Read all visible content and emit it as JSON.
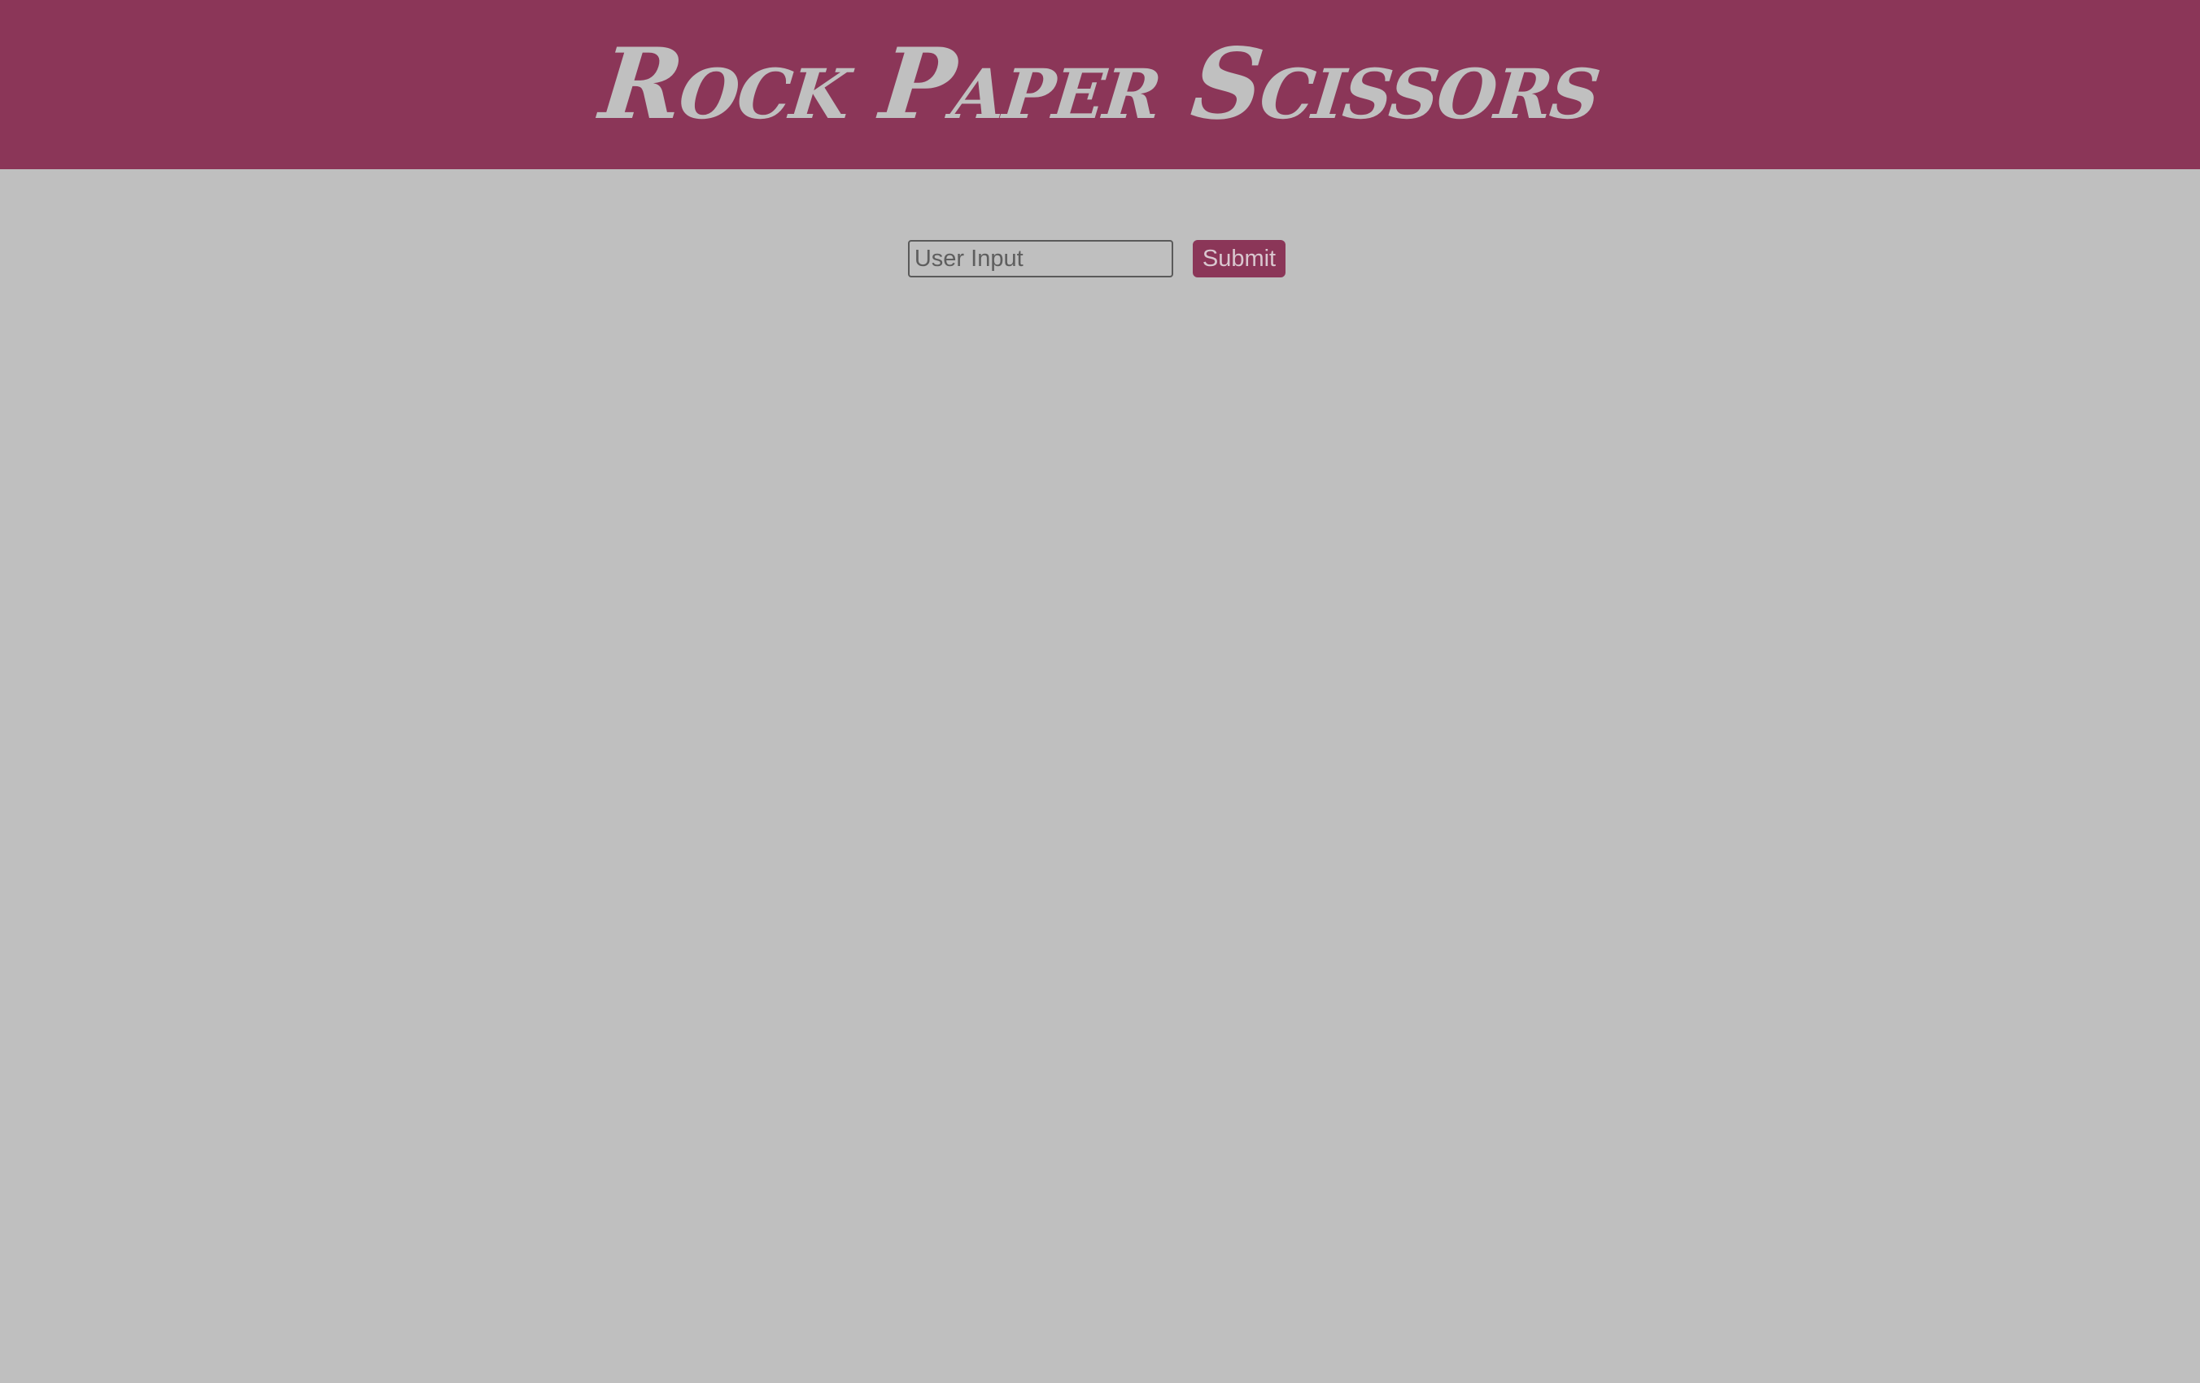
{
  "header": {
    "title": "Rock Paper Scissors"
  },
  "form": {
    "input": {
      "placeholder": "User Input",
      "value": ""
    },
    "submit_label": "Submit"
  },
  "colors": {
    "header_background": "#8b3658",
    "page_background": "#bfbfbf",
    "title_text": "#c0c0c0",
    "button_background": "#8b3658",
    "button_text": "#d9c7cf"
  }
}
